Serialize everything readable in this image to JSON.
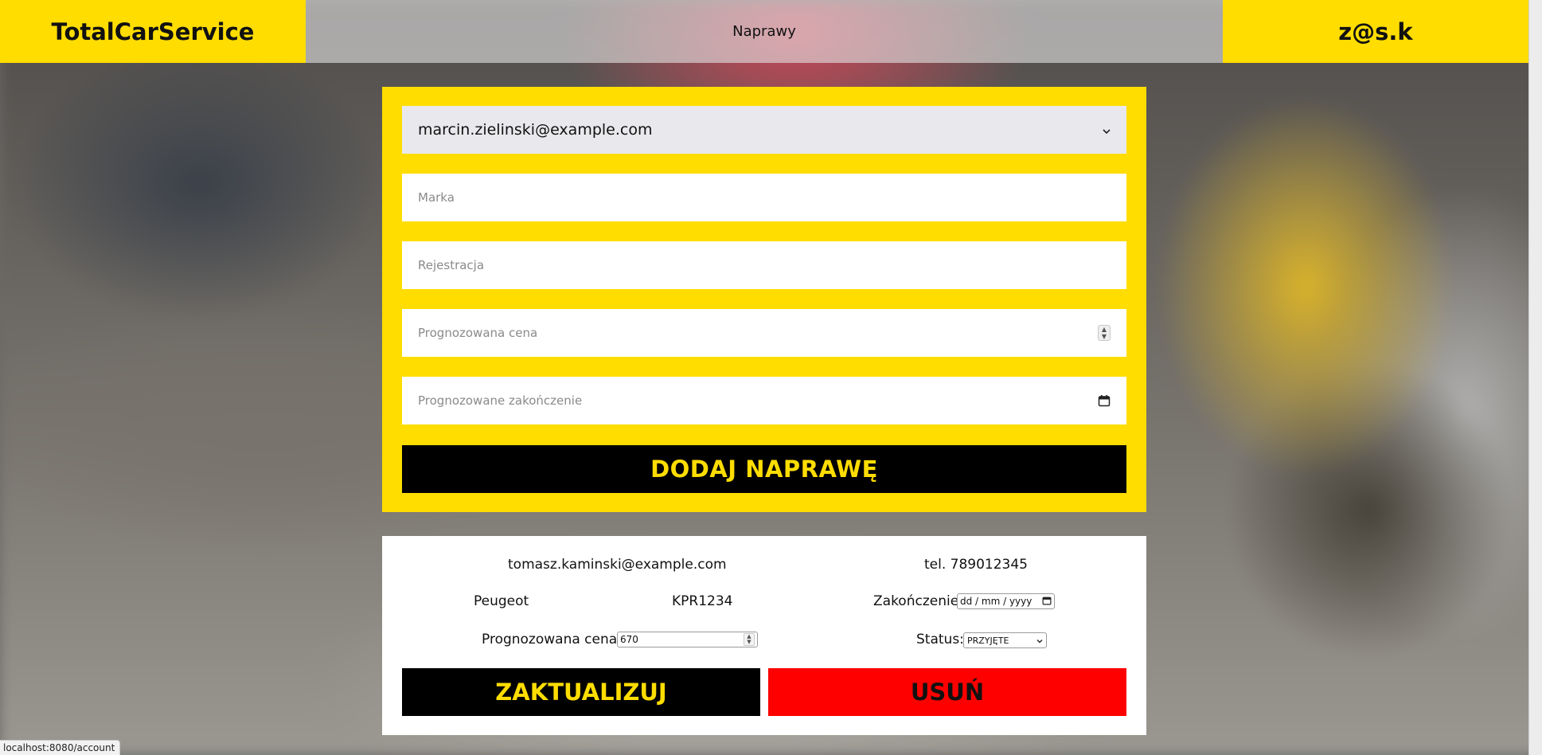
{
  "navbar": {
    "brand": "TotalCarService",
    "center_link": "Naprawy",
    "user": "z@s.k"
  },
  "add_form": {
    "client_select_value": "marcin.zielinski@example.com",
    "brand_placeholder": "Marka",
    "registration_placeholder": "Rejestracja",
    "price_placeholder": "Prognozowana cena",
    "end_date_placeholder": "Prognozowane zakończenie",
    "submit_label": "DODAJ NAPRAWĘ"
  },
  "repair_card": {
    "email": "tomasz.kaminski@example.com",
    "phone": "tel. 789012345",
    "brand": "Peugeot",
    "registration": "KPR1234",
    "end_label": "Zakończenie",
    "end_date_value": "dd / mm / yyyy",
    "price_label": "Prognozowana cena:",
    "price_value": "670",
    "status_label": "Status:",
    "status_value": "PRZYJĘTE",
    "update_label": "ZAKTUALIZUJ",
    "delete_label": "USUŃ"
  },
  "browser_status": {
    "url": "localhost:8080/account"
  },
  "colors": {
    "accent_yellow": "#ffdd00",
    "delete_red": "#ff0000",
    "button_black": "#000000"
  }
}
